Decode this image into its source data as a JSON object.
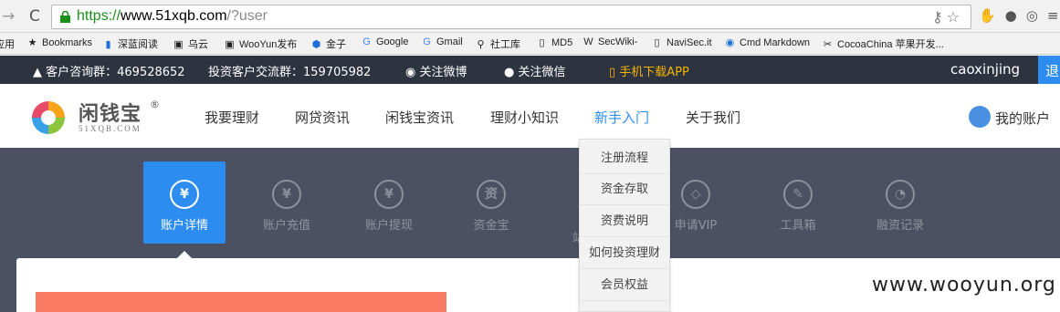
{
  "browser": {
    "back_icon": "arrow-back",
    "url_proto": "https://",
    "url_host": "www.51xqb.com",
    "url_path": "/?user",
    "bookmarks": [
      {
        "label": "应用",
        "icon": "apps"
      },
      {
        "label": "Bookmarks",
        "icon": "star"
      },
      {
        "label": "深蓝阅读",
        "icon": "bookmark"
      },
      {
        "label": "乌云",
        "icon": "site"
      },
      {
        "label": "WooYun发布",
        "icon": "site"
      },
      {
        "label": "金子",
        "icon": "site"
      },
      {
        "label": "Google",
        "icon": "google"
      },
      {
        "label": "Gmail",
        "icon": "google"
      },
      {
        "label": "社工库",
        "icon": "search"
      },
      {
        "label": "MD5",
        "icon": "page"
      },
      {
        "label": "SecWiki-",
        "icon": "wiki"
      },
      {
        "label": "NaviSec.it",
        "icon": "page"
      },
      {
        "label": "Cmd Markdown",
        "icon": "site"
      },
      {
        "label": "CocoaChina 苹果开发...",
        "icon": "site"
      }
    ]
  },
  "infobar": {
    "qq_group": "客户咨询群：469528652",
    "invest_group": "投资客户交流群：159705982",
    "weibo": "关注微博",
    "wechat": "关注微信",
    "app": "手机下载APP",
    "username": "caoxinjing",
    "logout": "退"
  },
  "header": {
    "logo_text": "闲钱宝",
    "logo_reg": "®",
    "logo_sub": "51XQB.COM",
    "menu": [
      "我要理财",
      "网贷资讯",
      "闲钱宝资讯",
      "理财小知识",
      "新手入门",
      "关于我们"
    ],
    "account": "我的账户"
  },
  "subnav": {
    "tiles": [
      {
        "label": "账户详情",
        "glyph": "¥"
      },
      {
        "label": "账户充值",
        "glyph": "¥"
      },
      {
        "label": "账户提现",
        "glyph": "¥"
      },
      {
        "label": "资金宝",
        "glyph": "资"
      },
      {
        "label": "",
        "glyph": ""
      },
      {
        "label": "申请VIP",
        "glyph": "◇"
      },
      {
        "label": "工具箱",
        "glyph": "✎"
      },
      {
        "label": "融资记录",
        "glyph": "◔"
      }
    ],
    "partial_label": "站"
  },
  "dropdown": [
    "注册流程",
    "资金存取",
    "资费说明",
    "如何投资理财",
    "会员权益"
  ],
  "watermark": "www.wooyun.org",
  "colors": {
    "accent": "#2d8cf0",
    "dark": "#2e3340",
    "subnav": "#4b5160",
    "red": "#f97b63",
    "app": "#f5b400"
  }
}
